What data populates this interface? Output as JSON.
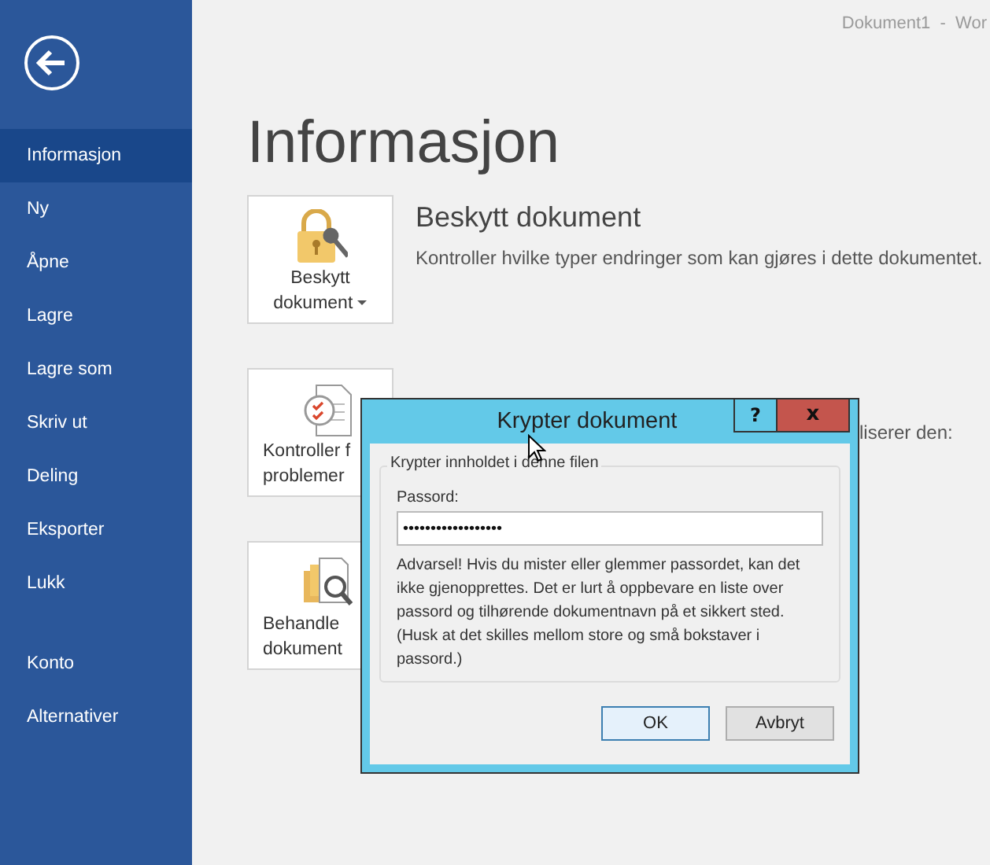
{
  "window": {
    "title": "Dokument1  -  Wor"
  },
  "sidebar": {
    "items": [
      {
        "label": "Informasjon",
        "selected": true
      },
      {
        "label": "Ny",
        "selected": false
      },
      {
        "label": "Åpne",
        "selected": false
      },
      {
        "label": "Lagre",
        "selected": false
      },
      {
        "label": "Lagre som",
        "selected": false
      },
      {
        "label": "Skriv ut",
        "selected": false
      },
      {
        "label": "Deling",
        "selected": false
      },
      {
        "label": "Eksporter",
        "selected": false
      },
      {
        "label": "Lukk",
        "selected": false
      },
      {
        "label": "Konto",
        "selected": false
      },
      {
        "label": "Alternativer",
        "selected": false
      }
    ]
  },
  "page_title": "Informasjon",
  "sections": [
    {
      "kind": "protect",
      "button_lines": [
        "Beskytt",
        "dokument"
      ],
      "dropdown": true,
      "heading": "Beskytt dokument",
      "description": "Kontroller hvilke typer endringer som kan gjøres i dette dokumentet."
    },
    {
      "kind": "inspect",
      "button_lines": [
        "Kontroller f",
        "problemer"
      ],
      "dropdown": false,
      "description": "liserer den:"
    },
    {
      "kind": "versions",
      "button_lines": [
        "Behandle",
        "dokument"
      ],
      "dropdown": false
    }
  ],
  "dialog": {
    "title": "Krypter dokument",
    "help": "?",
    "close": "x",
    "group": "Krypter innholdet i denne filen",
    "field_label": "Passord:",
    "password": "••••••••••••••••••",
    "warning": "Advarsel!  Hvis du mister eller glemmer passordet, kan det ikke gjenopprettes. Det er lurt å oppbevare en liste over passord og tilhørende dokumentnavn på et sikkert sted.",
    "note": "(Husk at det skilles mellom store og små bokstaver i passord.)",
    "buttons": [
      {
        "label": "OK",
        "default": true
      },
      {
        "label": "Avbryt",
        "default": false
      }
    ]
  }
}
